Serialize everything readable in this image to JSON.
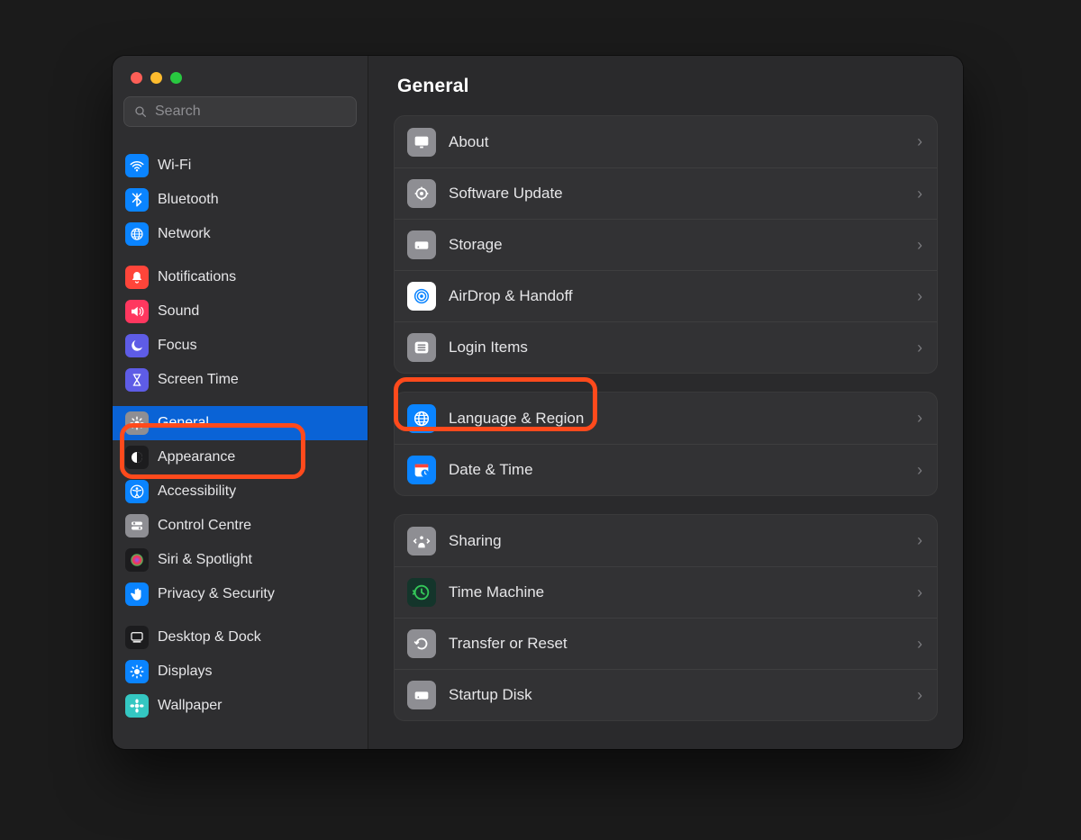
{
  "search": {
    "placeholder": "Search"
  },
  "sidebar": {
    "groups": [
      {
        "items": [
          {
            "id": "wifi",
            "label": "Wi-Fi",
            "icon": "wifi-icon",
            "bg": "#0a84ff"
          },
          {
            "id": "bluetooth",
            "label": "Bluetooth",
            "icon": "bluetooth-icon",
            "bg": "#0a84ff"
          },
          {
            "id": "network",
            "label": "Network",
            "icon": "globe-icon",
            "bg": "#0a84ff"
          }
        ]
      },
      {
        "items": [
          {
            "id": "notifications",
            "label": "Notifications",
            "icon": "bell-icon",
            "bg": "#ff453a"
          },
          {
            "id": "sound",
            "label": "Sound",
            "icon": "speaker-icon",
            "bg": "#ff375f"
          },
          {
            "id": "focus",
            "label": "Focus",
            "icon": "moon-icon",
            "bg": "#5e5ce6"
          },
          {
            "id": "screentime",
            "label": "Screen Time",
            "icon": "hourglass-icon",
            "bg": "#5e5ce6"
          }
        ]
      },
      {
        "items": [
          {
            "id": "general",
            "label": "General",
            "icon": "gear-icon",
            "bg": "#8e8e93",
            "selected": true
          },
          {
            "id": "appearance",
            "label": "Appearance",
            "icon": "contrast-icon",
            "bg": "#1c1c1e"
          },
          {
            "id": "accessibility",
            "label": "Accessibility",
            "icon": "accessibility-icon",
            "bg": "#0a84ff"
          },
          {
            "id": "controlcentre",
            "label": "Control Centre",
            "icon": "switches-icon",
            "bg": "#8e8e93"
          },
          {
            "id": "siri",
            "label": "Siri & Spotlight",
            "icon": "siri-icon",
            "bg": "#1c1c1e"
          },
          {
            "id": "privacy",
            "label": "Privacy & Security",
            "icon": "hand-icon",
            "bg": "#0a84ff"
          }
        ]
      },
      {
        "items": [
          {
            "id": "desktop",
            "label": "Desktop & Dock",
            "icon": "dock-icon",
            "bg": "#1c1c1e"
          },
          {
            "id": "displays",
            "label": "Displays",
            "icon": "sun-icon",
            "bg": "#0a84ff"
          },
          {
            "id": "wallpaper",
            "label": "Wallpaper",
            "icon": "flower-icon",
            "bg": "#34c7c2"
          }
        ]
      }
    ]
  },
  "main": {
    "title": "General",
    "panels": [
      {
        "rows": [
          {
            "id": "about",
            "label": "About",
            "icon": "monitor-icon",
            "bg": "#8e8e93"
          },
          {
            "id": "software-update",
            "label": "Software Update",
            "icon": "gear-badge-icon",
            "bg": "#8e8e93"
          },
          {
            "id": "storage",
            "label": "Storage",
            "icon": "drive-icon",
            "bg": "#8e8e93"
          },
          {
            "id": "airdrop",
            "label": "AirDrop & Handoff",
            "icon": "airdrop-icon",
            "bg": "#ffffff"
          },
          {
            "id": "login-items",
            "label": "Login Items",
            "icon": "list-icon",
            "bg": "#8e8e93"
          }
        ]
      },
      {
        "rows": [
          {
            "id": "language-region",
            "label": "Language & Region",
            "icon": "globe-icon",
            "bg": "#0a84ff"
          },
          {
            "id": "date-time",
            "label": "Date & Time",
            "icon": "calendar-clock-icon",
            "bg": "#0a84ff"
          }
        ]
      },
      {
        "rows": [
          {
            "id": "sharing",
            "label": "Sharing",
            "icon": "share-icon",
            "bg": "#8e8e93"
          },
          {
            "id": "time-machine",
            "label": "Time Machine",
            "icon": "timemachine-icon",
            "bg": "#14352b"
          },
          {
            "id": "transfer-reset",
            "label": "Transfer or Reset",
            "icon": "reset-icon",
            "bg": "#8e8e93"
          },
          {
            "id": "startup-disk",
            "label": "Startup Disk",
            "icon": "drive-icon",
            "bg": "#8e8e93"
          }
        ]
      }
    ]
  },
  "icons": {
    "wifi-icon": "<path d='M3 10c5-5 13-5 18 0M6 13c3.5-3.5 8.5-3.5 12 0M9 16c2-2 4-2 6 0' stroke='white' stroke-width='2' fill='none' stroke-linecap='round'/><circle cx='12' cy='19' r='1.6' fill='white'/>",
    "bluetooth-icon": "<path d='M12 3v18l6-6-6-6 6-6-6 6-6-6m0 12 6-6' stroke='white' stroke-width='2' fill='none' stroke-linejoin='round' stroke-linecap='round'/>",
    "globe-icon": "<circle cx='12' cy='12' r='8' stroke='white' stroke-width='1.6' fill='none'/><ellipse cx='12' cy='12' rx='3.5' ry='8' stroke='white' stroke-width='1.6' fill='none'/><path d='M4 12h16M5 8h14M5 16h14' stroke='white' stroke-width='1.4'/>",
    "bell-icon": "<path d='M12 4a5 5 0 0 1 5 5v4l2 3H5l2-3V9a5 5 0 0 1 5-5z' fill='white'/><path d='M10 18a2 2 0 0 0 4 0' stroke='white' stroke-width='1.6' fill='none'/>",
    "speaker-icon": "<path d='M4 9v6h4l5 4V5L8 9H4z' fill='white'/><path d='M16 8c2 2 2 6 0 8M18.5 6c3.5 3 3.5 9 0 12' stroke='white' stroke-width='1.6' fill='none' stroke-linecap='round'/>",
    "moon-icon": "<path d='M20 14A8 8 0 1 1 10 4a7 7 0 0 0 10 10z' fill='white'/>",
    "hourglass-icon": "<path d='M7 4h10M7 20h10M8 4c0 4 3 5 4 8-1 3-4 4-4 8M16 4c0 4-3 5-4 8 1 3 4 4 4 8' stroke='white' stroke-width='1.8' fill='none' stroke-linecap='round'/>",
    "gear-icon": "<circle cx='12' cy='12' r='3.2' fill='white'/><path d='M12 3v3M12 18v3M3 12h3M18 12h3M5.5 5.5l2 2M16.5 16.5l2 2M18.5 5.5l-2 2M7.5 16.5l-2 2' stroke='white' stroke-width='2' stroke-linecap='round'/>",
    "contrast-icon": "<circle cx='12' cy='12' r='8' fill='white'/><path d='M12 4a8 8 0 0 1 0 16z' fill='#1c1c1e'/>",
    "accessibility-icon": "<circle cx='12' cy='12' r='9' fill='none' stroke='white' stroke-width='1.6'/><circle cx='12' cy='7.5' r='1.8' fill='white'/><path d='M6 10l6 1 6-1M12 11v5m0 0-3 4m3-4 3 4' stroke='white' stroke-width='1.8' stroke-linecap='round'/>",
    "switches-icon": "<rect x='4' y='6' width='16' height='5' rx='2.5' fill='white'/><circle cx='8' cy='8.5' r='1.6' fill='#8e8e93'/><rect x='4' y='13' width='16' height='5' rx='2.5' fill='white'/><circle cx='16' cy='15.5' r='1.6' fill='#8e8e93'/>",
    "siri-icon": "<circle cx='12' cy='12' r='9' fill='url(#sg)'/><defs><radialGradient id='sg'><stop offset='0' stop-color='#7b61ff'/><stop offset='.6' stop-color='#ff2d55'/><stop offset='1' stop-color='#34c759'/></radialGradient></defs>",
    "hand-icon": "<path d='M9 12V6a1.5 1.5 0 1 1 3 0v5-6a1.5 1.5 0 1 1 3 0v7-5a1.5 1.5 0 1 1 3 0v8a6 6 0 0 1-6 6c-3 0-5-2-6-4l-3-5c-.6-1 .6-2.2 1.8-1.6L9 12z' fill='white'/>",
    "dock-icon": "<rect x='4' y='5' width='16' height='11' rx='2' stroke='white' stroke-width='1.6' fill='none'/><rect x='6' y='17.5' width='12' height='2' rx='1' fill='white'/>",
    "sun-icon": "<circle cx='12' cy='12' r='4' fill='white'/><g stroke='white' stroke-width='2' stroke-linecap='round'><path d='M12 3v2M12 19v2M3 12h2M19 12h2M5.6 5.6l1.4 1.4M17 17l1.4 1.4M18.4 5.6 17 7M7 17l-1.4 1.4'/></g>",
    "flower-icon": "<circle cx='12' cy='12' r='3' fill='white'/><g fill='white'><ellipse cx='12' cy='5' rx='2.2' ry='3'/><ellipse cx='12' cy='19' rx='2.2' ry='3'/><ellipse cx='5' cy='12' rx='3' ry='2.2'/><ellipse cx='19' cy='12' rx='3' ry='2.2'/></g>",
    "monitor-icon": "<rect x='4' y='5' width='16' height='11' rx='2' fill='white'/><rect x='10' y='17' width='4' height='2' fill='white'/>",
    "gear-badge-icon": "<circle cx='12' cy='12' r='6' stroke='white' stroke-width='1.8' fill='none'/><circle cx='12' cy='12' r='2.2' fill='white'/><g stroke='white' stroke-width='1.8'><path d='M12 4v2M12 18v2M4 12h2M18 12h2'/></g>",
    "drive-icon": "<rect x='4' y='8' width='16' height='9' rx='2' fill='white'/><circle cx='8' cy='14.5' r='1' fill='#8e8e93'/>",
    "airdrop-icon": "<circle cx='12' cy='12' r='8' stroke='#0a84ff' stroke-width='1.6' fill='none'/><circle cx='12' cy='12' r='5' stroke='#0a84ff' stroke-width='1.6' fill='none'/><circle cx='12' cy='12' r='2' fill='#0a84ff'/>",
    "list-icon": "<rect x='4' y='5' width='16' height='14' rx='3' fill='white'/><g stroke='#8e8e93' stroke-width='1.8' stroke-linecap='round'><path d='M8 9h8M8 12h8M8 15h8'/></g>",
    "calendar-clock-icon": "<rect x='4' y='5' width='16' height='15' rx='3' fill='white'/><rect x='4' y='5' width='16' height='4' fill='#ff453a'/><circle cx='16' cy='16' r='4.5' fill='#0a84ff'/><path d='M16 14v2.2l1.5 1' stroke='white' stroke-width='1.2' fill='none' stroke-linecap='round'/>",
    "share-icon": "<circle cx='12' cy='8' r='2' fill='white'/><path d='M8 20v-2a4 4 0 0 1 8 0v2' fill='white'/><path d='M5 10l-2 2 2 2M19 10l2 2-2 2' stroke='white' stroke-width='1.8' fill='none' stroke-linecap='round'/>",
    "timemachine-icon": "<circle cx='12' cy='12' r='8' stroke='#34c759' stroke-width='2' fill='none'/><path d='M12 8v4l3 2' stroke='#34c759' stroke-width='2' fill='none' stroke-linecap='round'/><path d='M4 12l-2-2m2 2-2 2' stroke='#34c759' stroke-width='2' stroke-linecap='round'/>",
    "reset-icon": "<path d='M6 12a6 6 0 1 1 2 4.5' stroke='white' stroke-width='2' fill='none' stroke-linecap='round'/><path d='M6 12l-2-2m2 2 2-2' stroke='white' stroke-width='2' stroke-linecap='round'/>"
  }
}
